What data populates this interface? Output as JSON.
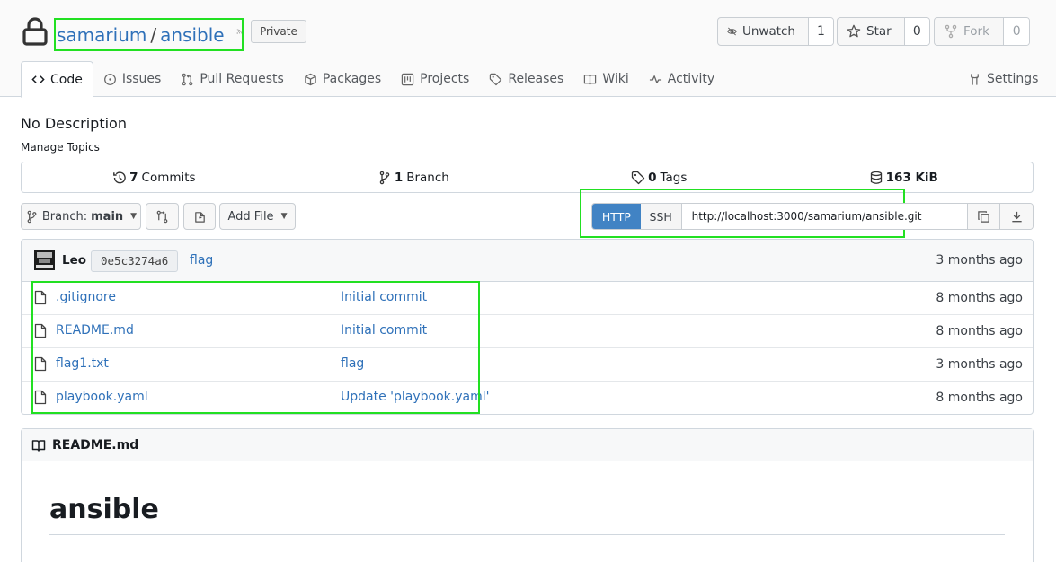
{
  "repo": {
    "owner": "samarium",
    "separator": "/",
    "name": "ansible",
    "visibility": "Private"
  },
  "actions": {
    "unwatch": {
      "label": "Unwatch",
      "count": "1"
    },
    "star": {
      "label": "Star",
      "count": "0"
    },
    "fork": {
      "label": "Fork",
      "count": "0"
    }
  },
  "tabs": [
    {
      "label": "Code",
      "icon": "code-icon"
    },
    {
      "label": "Issues",
      "icon": "issue-icon"
    },
    {
      "label": "Pull Requests",
      "icon": "pull-request-icon"
    },
    {
      "label": "Packages",
      "icon": "package-icon"
    },
    {
      "label": "Projects",
      "icon": "project-icon"
    },
    {
      "label": "Releases",
      "icon": "tag-icon"
    },
    {
      "label": "Wiki",
      "icon": "book-icon"
    },
    {
      "label": "Activity",
      "icon": "pulse-icon"
    },
    {
      "label": "Settings",
      "icon": "tools-icon"
    }
  ],
  "description": "No Description",
  "manage_topics": "Manage Topics",
  "stats": {
    "commits_count": "7",
    "commits_label": "Commits",
    "branch_count": "1",
    "branch_label": "Branch",
    "tags_count": "0",
    "tags_label": "Tags",
    "size": "163 KiB"
  },
  "toolbar": {
    "branch_prefix": "Branch:",
    "branch_name": "main",
    "add_file": "Add File"
  },
  "clone": {
    "http": "HTTP",
    "ssh": "SSH",
    "url": "http://localhost:3000/samarium/ansible.git"
  },
  "latest_commit": {
    "author": "Leo",
    "sha": "0e5c3274a6",
    "message": "flag",
    "age": "3 months ago"
  },
  "files": [
    {
      "name": ".gitignore",
      "message": "Initial commit",
      "age": "8 months ago"
    },
    {
      "name": "README.md",
      "message": "Initial commit",
      "age": "8 months ago"
    },
    {
      "name": "flag1.txt",
      "message": "flag",
      "age": "3 months ago"
    },
    {
      "name": "playbook.yaml",
      "message": "Update 'playbook.yaml'",
      "age": "8 months ago"
    }
  ],
  "readme": {
    "filename": "README.md",
    "heading": "ansible"
  },
  "colors": {
    "link": "#2f71b9",
    "accent": "#4183c4",
    "highlight": "#22e022"
  }
}
